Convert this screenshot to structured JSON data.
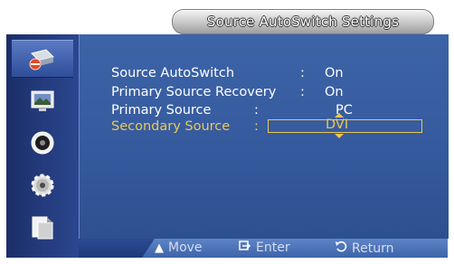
{
  "title": "Source AutoSwitch Settings",
  "sidebar": {
    "items": [
      {
        "icon": "input-icon",
        "active": true
      },
      {
        "icon": "picture-icon",
        "active": false
      },
      {
        "icon": "sound-icon",
        "active": false
      },
      {
        "icon": "setup-icon",
        "active": false
      },
      {
        "icon": "multi-control-icon",
        "active": false
      }
    ]
  },
  "settings": {
    "rows": [
      {
        "label": "Source AutoSwitch",
        "colon": ":",
        "value": "On"
      },
      {
        "label": "Primary Source Recovery",
        "colon": ":",
        "value": "On"
      },
      {
        "label": "Primary Source",
        "colon": ":",
        "value": "PC"
      },
      {
        "label": "Secondary Source",
        "colon": ":",
        "value": "DVI"
      }
    ]
  },
  "hints": {
    "move": "Move",
    "enter": "Enter",
    "return": "Return"
  },
  "colors": {
    "panel": "#3d64a8",
    "highlight": "#e8c85a",
    "sidebar": "#1c2e68"
  }
}
